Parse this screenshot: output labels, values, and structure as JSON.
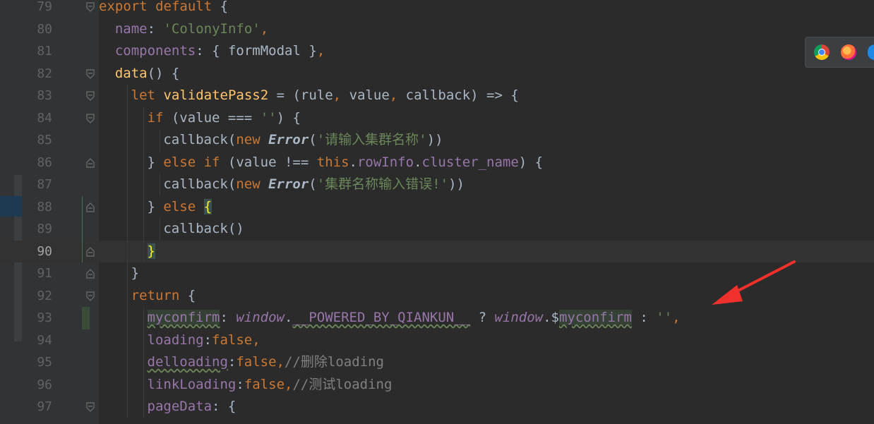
{
  "editor": {
    "current_line": "90",
    "lines": [
      {
        "num": "79",
        "parts": [
          [
            "kw",
            "export "
          ],
          [
            "kw",
            "default "
          ],
          [
            "pl",
            "{"
          ]
        ]
      },
      {
        "num": "80",
        "parts": [
          [
            "prop",
            "name"
          ],
          [
            "pl",
            ": "
          ],
          [
            "str",
            "'ColonyInfo'"
          ],
          [
            "kw",
            ","
          ]
        ]
      },
      {
        "num": "81",
        "parts": [
          [
            "prop",
            "components"
          ],
          [
            "pl",
            ": { formModal }"
          ],
          [
            "kw",
            ","
          ]
        ]
      },
      {
        "num": "82",
        "parts": [
          [
            "fn",
            "data"
          ],
          [
            "pl",
            "() {"
          ]
        ]
      },
      {
        "num": "83",
        "parts": [
          [
            "kw",
            "let "
          ],
          [
            "fn",
            "validatePass2"
          ],
          [
            "pl",
            " = (rule"
          ],
          [
            "kw",
            ", "
          ],
          [
            "pl",
            "value"
          ],
          [
            "kw",
            ", "
          ],
          [
            "pl",
            "callback) => {"
          ]
        ]
      },
      {
        "num": "84",
        "parts": [
          [
            "kw",
            "if "
          ],
          [
            "pl",
            "(value === "
          ],
          [
            "str",
            "''"
          ],
          [
            "pl",
            ") {"
          ]
        ]
      },
      {
        "num": "85",
        "parts": [
          [
            "pl",
            "callback("
          ],
          [
            "kw",
            "new "
          ],
          [
            "err",
            "Error"
          ],
          [
            "pl",
            "("
          ],
          [
            "str",
            "'请输入集群名称'"
          ],
          [
            "pl",
            "))"
          ]
        ]
      },
      {
        "num": "86",
        "parts": [
          [
            "pl",
            "} "
          ],
          [
            "kw",
            "else if "
          ],
          [
            "pl",
            "(value !== "
          ],
          [
            "kw",
            "this"
          ],
          [
            "pl",
            "."
          ],
          [
            "prop",
            "rowInfo"
          ],
          [
            "pl",
            "."
          ],
          [
            "prop",
            "cluster_name"
          ],
          [
            "pl",
            ") {"
          ]
        ]
      },
      {
        "num": "87",
        "parts": [
          [
            "pl",
            "callback("
          ],
          [
            "kw",
            "new "
          ],
          [
            "err",
            "Error"
          ],
          [
            "pl",
            "("
          ],
          [
            "str",
            "'集群名称输入错误!'"
          ],
          [
            "pl",
            "))"
          ]
        ]
      },
      {
        "num": "88",
        "parts": [
          [
            "pl",
            "} "
          ],
          [
            "kw",
            "else "
          ],
          [
            "brace",
            "{"
          ]
        ]
      },
      {
        "num": "89",
        "parts": [
          [
            "pl",
            "callback()"
          ]
        ]
      },
      {
        "num": "90",
        "parts": [
          [
            "brace",
            "}"
          ]
        ]
      },
      {
        "num": "91",
        "parts": [
          [
            "pl",
            "}"
          ]
        ]
      },
      {
        "num": "92",
        "parts": [
          [
            "kw",
            "return "
          ],
          [
            "pl",
            "{"
          ]
        ]
      },
      {
        "num": "93",
        "parts": [
          [
            "propw",
            "myconfirm"
          ],
          [
            "pl",
            ": "
          ],
          [
            "propi",
            "window"
          ],
          [
            "pl",
            "."
          ],
          [
            "propwu",
            "__POWERED_BY_QIANKUN__"
          ],
          [
            "pl",
            " ? "
          ],
          [
            "propi",
            "window"
          ],
          [
            "pl",
            ".$"
          ],
          [
            "propw",
            "myconfirm"
          ],
          [
            "pl",
            " : "
          ],
          [
            "str",
            "''"
          ],
          [
            "kw",
            ","
          ]
        ]
      },
      {
        "num": "94",
        "parts": [
          [
            "prop",
            "loading"
          ],
          [
            "pl",
            ":"
          ],
          [
            "kw",
            "false,"
          ]
        ]
      },
      {
        "num": "95",
        "parts": [
          [
            "propu",
            "delloading"
          ],
          [
            "pl",
            ":"
          ],
          [
            "kw",
            "false,"
          ],
          [
            "com",
            "//删除loading"
          ]
        ]
      },
      {
        "num": "96",
        "parts": [
          [
            "prop",
            "linkLoading"
          ],
          [
            "pl",
            ":"
          ],
          [
            "kw",
            "false,"
          ],
          [
            "com",
            "//测试loading"
          ]
        ]
      },
      {
        "num": "97",
        "parts": [
          [
            "prop",
            "pageData"
          ],
          [
            "pl",
            ": {"
          ]
        ]
      }
    ]
  },
  "browser_icons": [
    "chrome-icon",
    "firefox-icon",
    "safari-icon"
  ],
  "colors": {
    "background": "#2b2b2b",
    "keyword": "#cc7832",
    "string": "#6a8759",
    "function": "#ffc66d",
    "property": "#9876aa",
    "annotation_arrow": "#f0302a"
  }
}
